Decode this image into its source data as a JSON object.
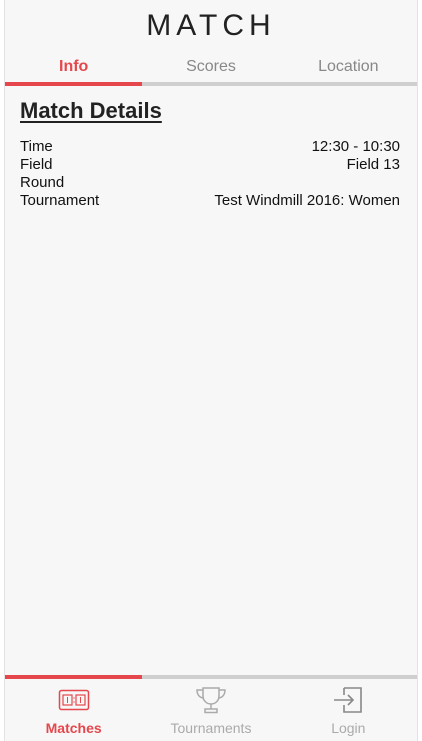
{
  "header": {
    "title": "MATCH"
  },
  "tabs": [
    {
      "label": "Info",
      "active": true
    },
    {
      "label": "Scores",
      "active": false
    },
    {
      "label": "Location",
      "active": false
    }
  ],
  "details": {
    "heading": "Match Details",
    "rows": [
      {
        "label": "Time",
        "value": "12:30 - 10:30"
      },
      {
        "label": "Field",
        "value": "Field 13"
      },
      {
        "label": "Round",
        "value": ""
      },
      {
        "label": "Tournament",
        "value": "Test Windmill 2016: Women"
      }
    ]
  },
  "bottom_nav": [
    {
      "label": "Matches",
      "icon": "scoreboard-icon",
      "active": true
    },
    {
      "label": "Tournaments",
      "icon": "trophy-icon",
      "active": false
    },
    {
      "label": "Login",
      "icon": "login-icon",
      "active": false
    }
  ],
  "colors": {
    "accent": "#e5474c",
    "inactive": "#aaaaaa",
    "divider": "#cfcfcf"
  }
}
